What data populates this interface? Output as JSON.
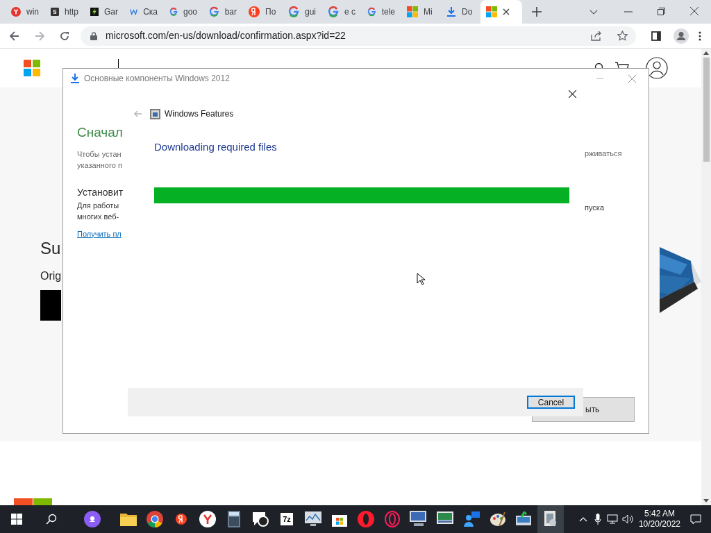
{
  "browser": {
    "tabs": [
      {
        "kind": "y",
        "label": "win",
        "selected": false
      },
      {
        "kind": "s",
        "label": "http",
        "selected": false
      },
      {
        "kind": "bolt",
        "label": "Gar",
        "selected": false
      },
      {
        "kind": "w",
        "label": "Ска",
        "selected": false
      },
      {
        "kind": "g",
        "label": "goo",
        "selected": false
      },
      {
        "kind": "g",
        "label": "bar",
        "selected": false
      },
      {
        "kind": "ya",
        "label": "По",
        "selected": false
      },
      {
        "kind": "g",
        "label": "gui",
        "selected": false
      },
      {
        "kind": "g",
        "label": "e c",
        "selected": false
      },
      {
        "kind": "g",
        "label": "tele",
        "selected": false
      },
      {
        "kind": "ms",
        "label": "Mi",
        "selected": false
      },
      {
        "kind": "download",
        "label": "Do",
        "selected": false
      },
      {
        "kind": "ms",
        "selected": true
      }
    ],
    "url": "microsoft.com/en-us/download/confirmation.aspx?id=22"
  },
  "site": {
    "heading": "Su",
    "subheading": "Orig"
  },
  "setup_window": {
    "title": "Основные компоненты Windows 2012",
    "heading": "Сначал",
    "intro": [
      "Чтобы устан",
      "указанного п"
    ],
    "subheading": "Установит",
    "body": [
      "Для работы",
      "многих веб-"
    ],
    "link": "Получить пл",
    "right_texts": [
      "рживаться",
      "пуска"
    ],
    "button": "ыть"
  },
  "features_dialog": {
    "title": "Windows Features",
    "status": "Downloading required files",
    "progress": {
      "level": 1
    },
    "cancel": "Cancel"
  },
  "taskbar": {
    "apps": [
      {
        "kind": "assistant",
        "selected": false
      },
      {
        "kind": "folder",
        "selected": false
      },
      {
        "kind": "chrome",
        "selected": false
      },
      {
        "kind": "ya",
        "selected": false
      },
      {
        "kind": "y",
        "selected": false
      },
      {
        "kind": "calculator",
        "selected": false
      },
      {
        "kind": "help",
        "selected": false
      },
      {
        "kind": "archiver",
        "label": "7z",
        "selected": false
      },
      {
        "kind": "monitor",
        "selected": false
      },
      {
        "kind": "store",
        "selected": false
      },
      {
        "kind": "opera",
        "selected": false
      },
      {
        "kind": "opera-gx",
        "selected": false
      },
      {
        "kind": "remote",
        "selected": false
      },
      {
        "kind": "screen",
        "selected": false
      },
      {
        "kind": "people",
        "selected": false
      },
      {
        "kind": "paint",
        "selected": false
      },
      {
        "kind": "installer",
        "selected": false
      },
      {
        "kind": "features",
        "selected": true
      }
    ],
    "time": "5:42 AM",
    "date": "10/20/2022"
  }
}
